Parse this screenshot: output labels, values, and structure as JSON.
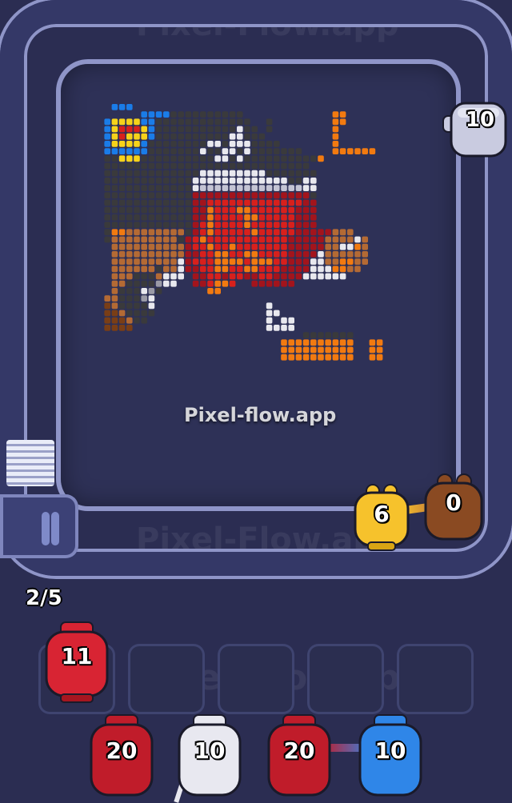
{
  "watermark": "Pixel-Flow.app",
  "watermark_center": "Pixel-flow.app",
  "progress_counter": "2/5",
  "conveyor_pigs": [
    {
      "label": "10",
      "color": "#c9cbe0"
    },
    {
      "label": "6",
      "color": "#f6c22c"
    },
    {
      "label": "0",
      "color": "#8a4a22"
    }
  ],
  "holding_pigs": [
    {
      "label": "11",
      "color": "#d82433"
    }
  ],
  "queue_pigs": [
    {
      "label": "20",
      "color": "#c01c2a"
    },
    {
      "label": "10",
      "color": "#e8e8f0"
    },
    {
      "label": "20",
      "color": "#c01c2a"
    },
    {
      "label": "10",
      "color": "#2f86e8"
    }
  ],
  "palette": {
    "K": "#3a3a3c",
    "W": "#e8e8ee",
    "G": "#9a9aa6",
    "R": "#d8201c",
    "D": "#a3141c",
    "O": "#f27a10",
    "B": "#b46a34",
    "N": "#7a3e16",
    "Y": "#f6d21a",
    "U": "#1a7ce8",
    "S": "#c4c4d4"
  },
  "pixel_rows": [
    "...UUU...........................",
    ".......UUUUKKKKKKKKKK............OO....",
    "..UYYYYUUKKKKKKKKKKKKK..K........OO....",
    "..UYRRRYUKKKKKKKKKKKWKK.K........O.....",
    "..UYRYYYUKKKKKKKKKKWWKKK.........O.....",
    "..UYYYYUKKKKKKKKWWKWWWKKKK.......O.....",
    "..UUUUUUKKKKKKKWKKWWKWKKKKKKK....OOOOOO",
    "..KKYYYKKKKKKKKKKWWKWKKKKKKKKKKO.......",
    "..KKKKKKKKKKKKKKKKKKKKKKKKKKKK..........",
    "..KKKKKKKKKKKKKWWWWWWWWWKKKKKKK.........",
    "..KKKKKKKKKKKKWWWWWWWWWWWWWKKWW.........",
    "..KKKKKKKKKKKKWSSSSSSSSSSSSSSWW.........",
    "..KKKKKKKKKKKKDDDDDDDDDDDDDDDDK.........",
    "..KKKKKKKKKKKKDDRRRRRRRRRRRRRDD.........",
    "..KKKKKKKKKKKKDDORRROORRRRRRDDD.........",
    "..KKKKKKKKKKKKDDORRRROORRRRRDDD.........",
    "..KKKKKKKKKKKKDRORRRRORRRRRRDDD.........",
    "..KOOBBBBBBBBKDRORRRRRORRRRRDDDDDBBB.....",
    "..KBBBBBBBBBKDRORRRRRRRRRRRDDDDDBBBBWB...",
    "...BBBBBBBBBBDRRORRORRRRRRRDDDDDBBWWOB...",
    "...BBBBBBBBBBDDRROORROORRRRDDDDWBBBBBB...",
    "...BBBBBBBBBWDRRROOOOROOORRDDDWWBBOOBB...",
    "...BBBBBBKBBWDDRROORROORRRDDDDWWWOOBB....",
    "...BBBKKKBWWW.DDRRDRRDDRRDDDDWWWWWW.....",
    "...BBKKKKGWW..DDROOR..DDDDDD............",
    "...BKKKWGK......OO......................",
    "..BBKKKGW...............................",
    "..NBKKKKW...............W...............",
    "..NNBKKKK...............WW..............",
    "..NNNBKK................W.WW............",
    "..NNNN..................WWWW............",
    ".............................KKKKKKK....",
    "..........................OOOOOOOOOO..OO",
    "..........................OOOOOOOOOO..OO",
    "..........................OOOOOOOOOO..OO"
  ]
}
